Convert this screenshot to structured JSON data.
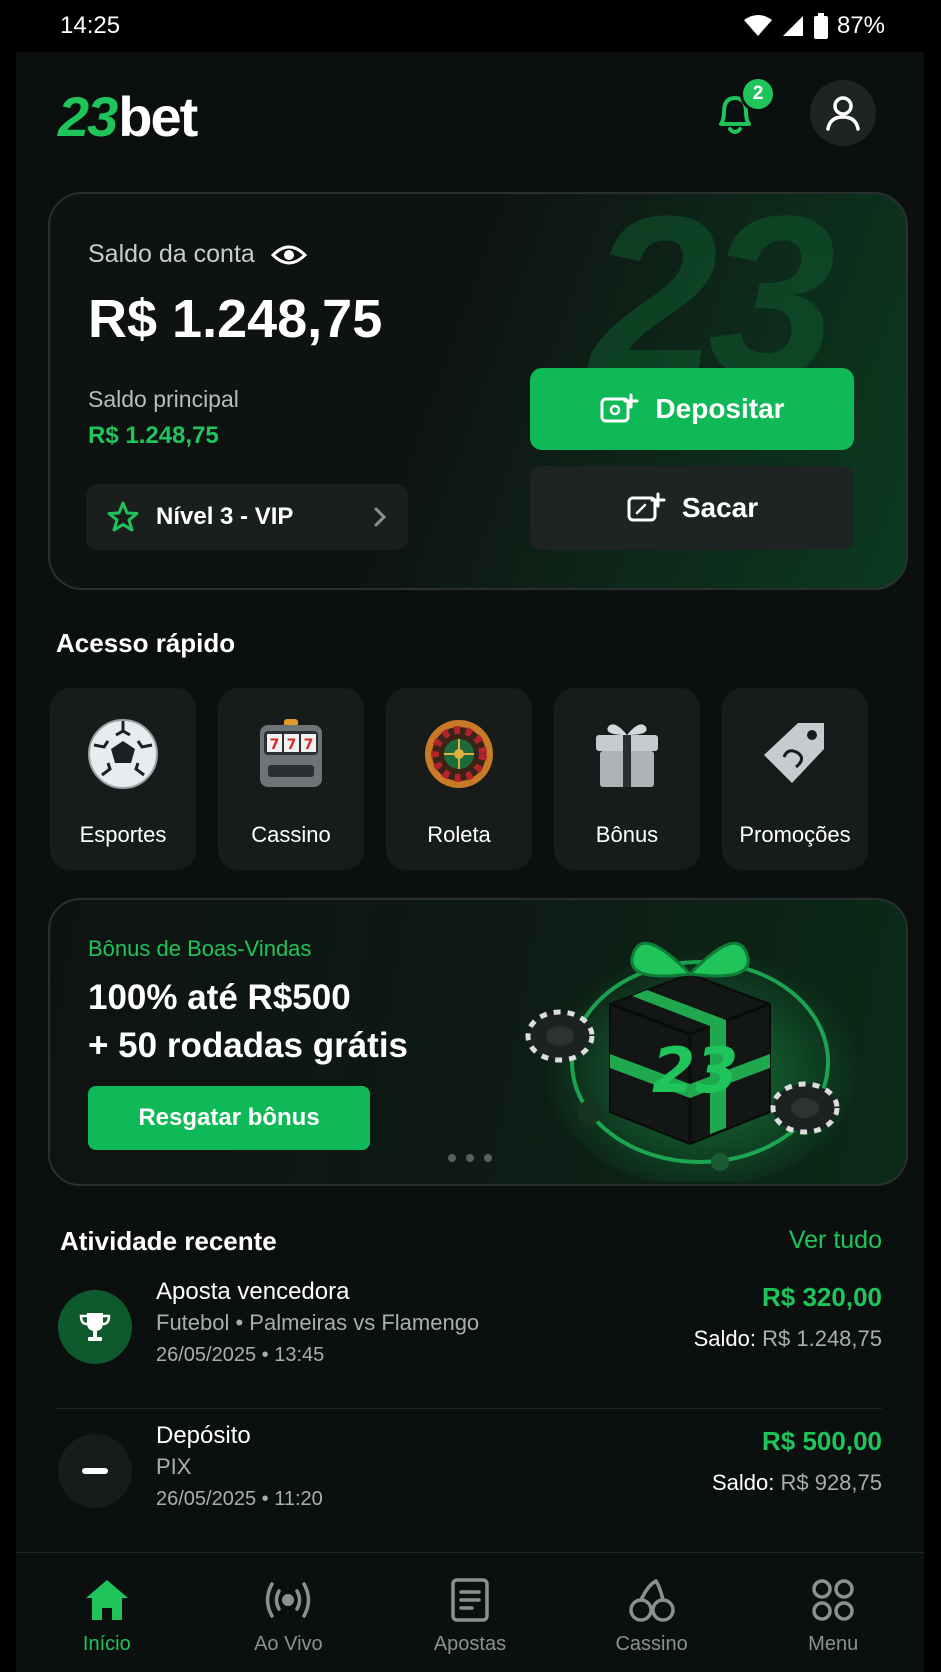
{
  "status_bar": {
    "time": "14:25",
    "battery": "87%"
  },
  "header": {
    "logo_number": "23",
    "logo_text": "bet",
    "notifications_count": "2"
  },
  "balance": {
    "label": "Saldo da conta",
    "amount": "R$ 1.248,75",
    "main_label": "Saldo principal",
    "main_value": "R$ 1.248,75",
    "vip_label": "Nível 3 - VIP",
    "deposit_label": "Depositar",
    "withdraw_label": "Sacar",
    "background_mark": "23"
  },
  "quick_access": {
    "title": "Acesso rápido",
    "items": [
      {
        "label": "Esportes",
        "icon": "soccer-ball-icon"
      },
      {
        "label": "Cassino",
        "icon": "slot-machine-icon"
      },
      {
        "label": "Roleta",
        "icon": "roulette-icon"
      },
      {
        "label": "Bônus",
        "icon": "gift-icon"
      },
      {
        "label": "Promoções",
        "icon": "tag-icon"
      }
    ]
  },
  "promo": {
    "kicker": "Bônus de Boas-Vindas",
    "line1": "100% até R$500",
    "line2": "+ 50 rodadas grátis",
    "button": "Resgatar bônus",
    "art_mark": "23",
    "page_count": 3
  },
  "recent": {
    "title": "Atividade recente",
    "see_all": "Ver tudo",
    "items": [
      {
        "title": "Aposta vencedora",
        "subtitle": "Futebol • Palmeiras vs Flamengo",
        "datetime": "26/05/2025 • 13:45",
        "amount": "R$ 320,00",
        "balance_label": "Saldo:",
        "balance_value": "R$ 1.248,75",
        "icon": "trophy-icon"
      },
      {
        "title": "Depósito",
        "subtitle": "PIX",
        "datetime": "26/05/2025 • 11:20",
        "amount": "R$ 500,00",
        "balance_label": "Saldo:",
        "balance_value": "R$ 928,75",
        "icon": "minus-icon"
      }
    ]
  },
  "bottom_nav": {
    "items": [
      {
        "label": "Início",
        "icon": "home-icon",
        "active": true
      },
      {
        "label": "Ao Vivo",
        "icon": "live-icon",
        "active": false
      },
      {
        "label": "Apostas",
        "icon": "bets-icon",
        "active": false
      },
      {
        "label": "Cassino",
        "icon": "cherry-icon",
        "active": false
      },
      {
        "label": "Menu",
        "icon": "grid-icon",
        "active": false
      }
    ]
  },
  "colors": {
    "accent": "#1fc45a",
    "button": "#10b957",
    "background": "#0b0f0e",
    "card": "#171c1b"
  }
}
